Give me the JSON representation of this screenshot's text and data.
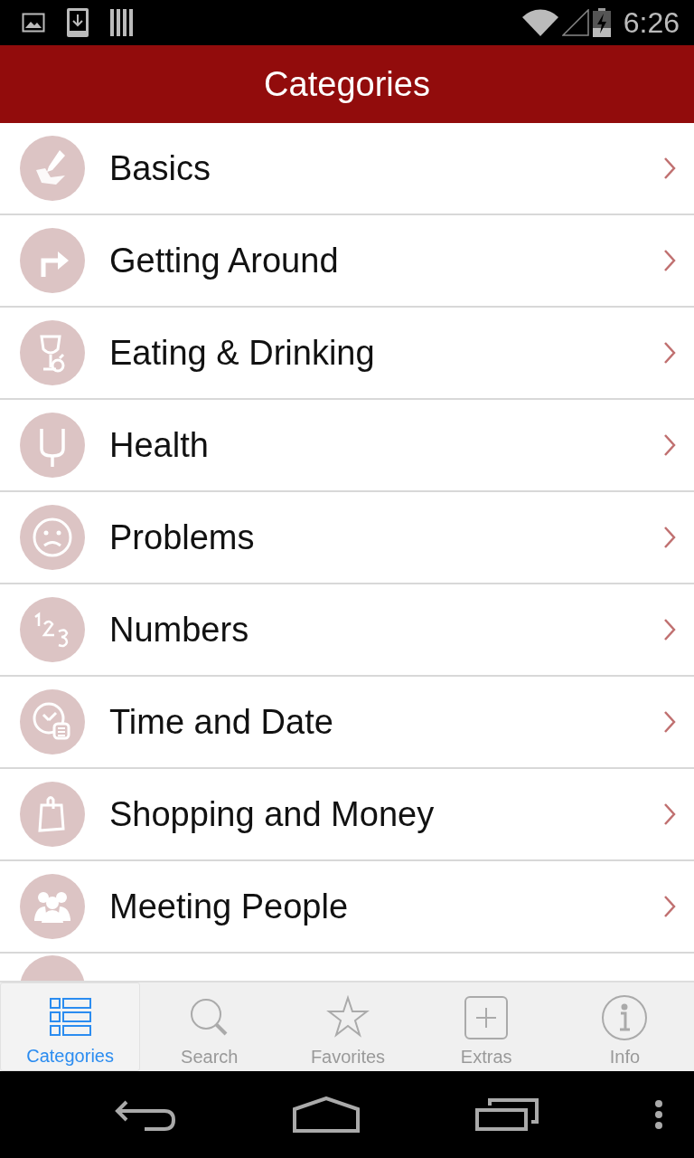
{
  "status_bar": {
    "time": "6:26"
  },
  "header": {
    "title": "Categories"
  },
  "categories": [
    {
      "label": "Basics"
    },
    {
      "label": "Getting Around"
    },
    {
      "label": "Eating & Drinking"
    },
    {
      "label": "Health"
    },
    {
      "label": "Problems"
    },
    {
      "label": "Numbers"
    },
    {
      "label": "Time and Date"
    },
    {
      "label": "Shopping and Money"
    },
    {
      "label": "Meeting People"
    }
  ],
  "tabs": [
    {
      "label": "Categories",
      "selected": true
    },
    {
      "label": "Search",
      "selected": false
    },
    {
      "label": "Favorites",
      "selected": false
    },
    {
      "label": "Extras",
      "selected": false
    },
    {
      "label": "Info",
      "selected": false
    }
  ]
}
